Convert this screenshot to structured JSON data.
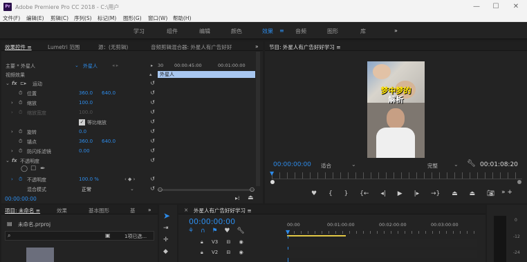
{
  "app": {
    "title": "Adobe Premiere Pro CC 2018 - C:\\用户",
    "logo_text": "Pr",
    "window_controls": {
      "minimize": "—",
      "maximize": "☐",
      "close": "✕"
    }
  },
  "menu": [
    "文件(F)",
    "编辑(E)",
    "剪辑(C)",
    "序列(S)",
    "标记(M)",
    "图形(G)",
    "窗口(W)",
    "帮助(H)"
  ],
  "workspaces": {
    "items": [
      "学习",
      "组件",
      "编辑",
      "颜色",
      "效果",
      "音频",
      "图形",
      "库"
    ],
    "active": "效果",
    "active_suffix": "≡",
    "more": "»"
  },
  "effect_controls": {
    "tabs": [
      "效果控件 ≡",
      "Lumetri 范围",
      "源：(无剪辑)",
      "音频剪辑混合器: 外星人有广告好好"
    ],
    "more": "»",
    "clip_master": "主要 * 外星人",
    "clip_sequence": "外星人",
    "video_effects": "视频效果",
    "motion": "运动",
    "position": {
      "label": "位置",
      "x": "360.0",
      "y": "640.0"
    },
    "scale": {
      "label": "缩放",
      "value": "100.0"
    },
    "scale_width": {
      "label": "缩放宽度",
      "value": "100.0"
    },
    "uniform_scale": "等比缩放",
    "rotation": {
      "label": "旋转",
      "value": "0.0"
    },
    "anchor": {
      "label": "锚点",
      "x": "360.0",
      "y": "640.0"
    },
    "anti_flicker": {
      "label": "防闪烁滤镜",
      "value": "0.00"
    },
    "opacity_group": "不透明度",
    "opacity": {
      "label": "不透明度",
      "value": "100.0 %"
    },
    "blend_mode": {
      "label": "混合模式",
      "value": "正常"
    },
    "timecode": "00:00:00:00",
    "mini_timeline": {
      "t0": "00:00:45:00",
      "t1": "00:01:00:00",
      "clip": "外星人",
      "head": "30"
    }
  },
  "program": {
    "title": "节目: 外星人有广告好好学习 ≡",
    "video_caption_1": "梦中梦的",
    "video_caption_2": "解析",
    "timecode": "00:00:00:00",
    "fit": "适合",
    "quality": "完整",
    "duration": "00:01:08:20"
  },
  "project": {
    "tabs": [
      "项目: 未命名 ≡",
      "效果",
      "基本图形",
      "基"
    ],
    "more": "»",
    "file": "未命名.prproj",
    "selected": "1项已选..."
  },
  "timeline": {
    "title": "外星人有广告好好学习 ≡",
    "timecode": "00:00:00:00",
    "ruler": [
      "00:00",
      "00:01:00:00",
      "00:02:00:00",
      "00:03:00:00"
    ],
    "tracks": [
      "V3",
      "V2"
    ]
  },
  "audio_meter": {
    "ticks": [
      "0",
      "-12",
      "-24"
    ]
  },
  "colors": {
    "accent": "#2d8ceb",
    "clip": "#a8c7f0",
    "workarea": "#e3c845"
  }
}
